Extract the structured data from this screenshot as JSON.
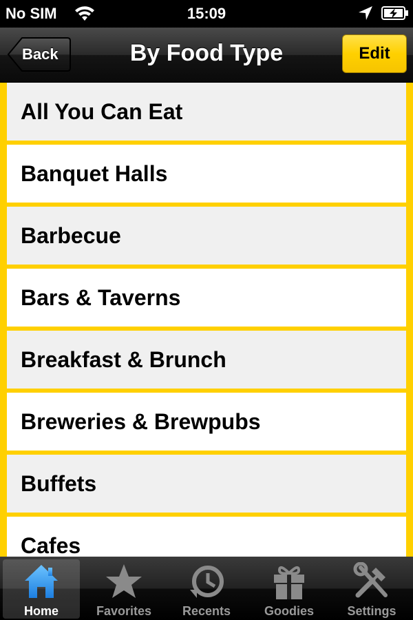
{
  "status_bar": {
    "carrier": "No SIM",
    "time": "15:09"
  },
  "nav": {
    "back_label": "Back",
    "title": "By Food Type",
    "edit_label": "Edit"
  },
  "list": {
    "items": [
      "All You Can Eat",
      "Banquet Halls",
      "Barbecue",
      "Bars & Taverns",
      "Breakfast & Brunch",
      "Breweries & Brewpubs",
      "Buffets",
      "Cafes"
    ]
  },
  "tabbar": {
    "tabs": [
      {
        "label": "Home",
        "icon": "home-icon",
        "active": true
      },
      {
        "label": "Favorites",
        "icon": "star-icon",
        "active": false
      },
      {
        "label": "Recents",
        "icon": "clock-icon",
        "active": false
      },
      {
        "label": "Goodies",
        "icon": "gift-icon",
        "active": false
      },
      {
        "label": "Settings",
        "icon": "tools-icon",
        "active": false
      }
    ]
  },
  "colors": {
    "accent": "#ffd000",
    "row_alt": "#f0f0f0",
    "row": "#ffffff",
    "active_tab_icon": "#2f9bff"
  }
}
